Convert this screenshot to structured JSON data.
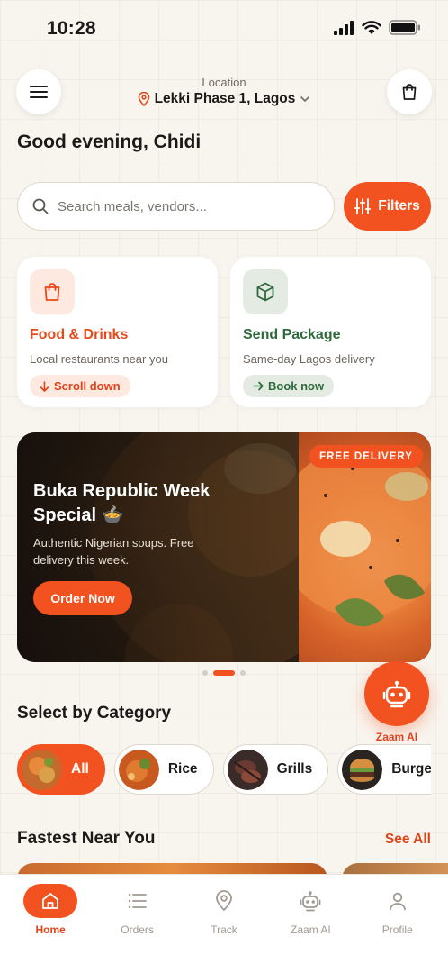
{
  "status_bar": {
    "time": "10:28"
  },
  "header": {
    "location_label": "Location",
    "location_value": "Lekki Phase 1, Lagos"
  },
  "greeting": "Good evening, Chidi",
  "search": {
    "placeholder": "Search meals, vendors...",
    "value": ""
  },
  "filters_label": "Filters",
  "services": [
    {
      "title": "Food & Drinks",
      "subtitle": "Local restaurants near you",
      "action": "Scroll down",
      "icon": "shopping-bag-icon"
    },
    {
      "title": "Send Package",
      "subtitle": "Same-day Lagos delivery",
      "action": "Book now",
      "icon": "package-icon"
    }
  ],
  "banner": {
    "title": "Buka Republic Week Special 🍲",
    "description": "Authentic Nigerian soups. Free delivery this week.",
    "cta": "Order Now",
    "badge": "FREE DELIVERY",
    "slide_count": 3,
    "active_slide": 1
  },
  "ai_fab": {
    "label": "Zaam AI",
    "icon": "robot-icon"
  },
  "categories": {
    "title": "Select by Category",
    "items": [
      {
        "label": "All",
        "active": true
      },
      {
        "label": "Rice",
        "active": false
      },
      {
        "label": "Grills",
        "active": false
      },
      {
        "label": "Burgers",
        "active": false
      }
    ]
  },
  "fastest": {
    "title": "Fastest Near You",
    "see_all": "See All"
  },
  "nav": [
    {
      "label": "Home",
      "icon": "home-icon",
      "active": true
    },
    {
      "label": "Orders",
      "icon": "list-icon",
      "active": false
    },
    {
      "label": "Track",
      "icon": "map-pin-icon",
      "active": false
    },
    {
      "label": "Zaam AI",
      "icon": "robot-icon",
      "active": false
    },
    {
      "label": "Profile",
      "icon": "user-icon",
      "active": false
    }
  ],
  "colors": {
    "accent": "#f2521f",
    "food": "#e8491a",
    "package": "#2f6a3c",
    "background": "#f8f4ee"
  }
}
